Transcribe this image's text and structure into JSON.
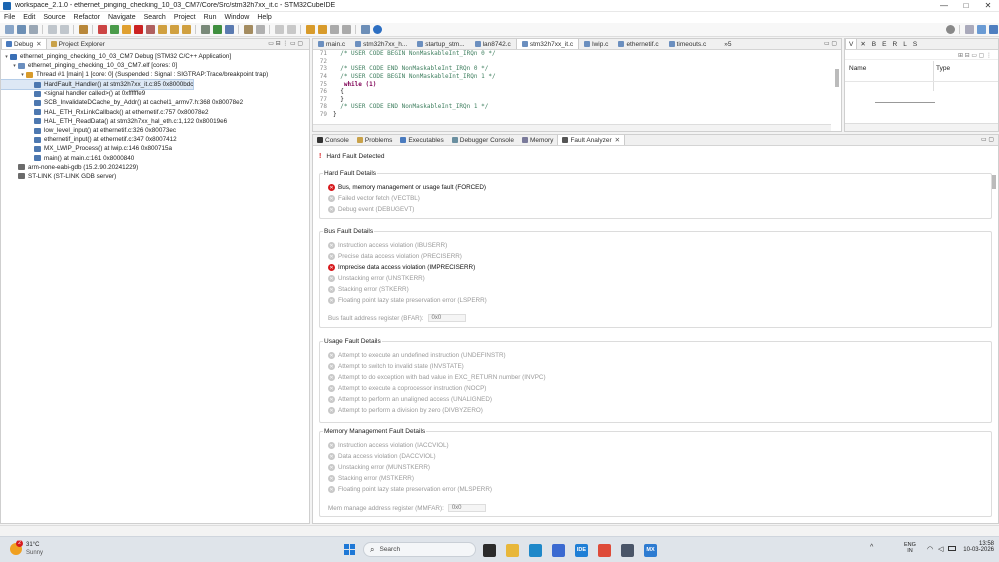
{
  "window": {
    "title": "workspace_2.1.0 - ethernet_pinging_checking_10_03_CM7/Core/Src/stm32h7xx_it.c - STM32CubeIDE",
    "controls": [
      "—",
      "□",
      "✕"
    ]
  },
  "menu": [
    "File",
    "Edit",
    "Source",
    "Refactor",
    "Navigate",
    "Search",
    "Project",
    "Run",
    "Window",
    "Help"
  ],
  "debug_panel": {
    "tabs": [
      {
        "label": "Debug"
      },
      {
        "label": "Project Explorer"
      }
    ],
    "tree": [
      {
        "indent": 0,
        "text": "ethernet_pinging_checking_10_03_CM7 Debug [STM32 C/C++ Application]",
        "twisty": "▾",
        "color": "#3a6fb5"
      },
      {
        "indent": 1,
        "text": "ethernet_pinging_checking_10_03_CM7.elf [cores: 0]",
        "twisty": "▾",
        "color": "#6b8fbf"
      },
      {
        "indent": 2,
        "text": "Thread #1 [main] 1 [core: 0] (Suspended : Signal : SIGTRAP:Trace/breakpoint trap)",
        "twisty": "▾",
        "color": "#d89b2b"
      },
      {
        "indent": 3,
        "text": "HardFault_Handler() at stm32h7xx_it.c:85 0x8000bdc",
        "twisty": "",
        "color": "#4d78b0",
        "selected": true
      },
      {
        "indent": 3,
        "text": "<signal handler called>() at 0xffffffe9",
        "twisty": "",
        "color": "#4d78b0"
      },
      {
        "indent": 3,
        "text": "SCB_InvalidateDCache_by_Addr() at cachel1_armv7.h:368 0x80078e2",
        "twisty": "",
        "color": "#4d78b0"
      },
      {
        "indent": 3,
        "text": "HAL_ETH_RxLinkCallback() at ethernetif.c:757 0x80078e2",
        "twisty": "",
        "color": "#4d78b0"
      },
      {
        "indent": 3,
        "text": "HAL_ETH_ReadData() at stm32h7xx_hal_eth.c:1,122 0x80019e6",
        "twisty": "",
        "color": "#4d78b0"
      },
      {
        "indent": 3,
        "text": "low_level_input() at ethernetif.c:326 0x80073ec",
        "twisty": "",
        "color": "#4d78b0"
      },
      {
        "indent": 3,
        "text": "ethernetif_input() at ethernetif.c:347 0x8007412",
        "twisty": "",
        "color": "#4d78b0"
      },
      {
        "indent": 3,
        "text": "MX_LWIP_Process() at lwip.c:146 0x800715a",
        "twisty": "",
        "color": "#4d78b0"
      },
      {
        "indent": 3,
        "text": "main() at main.c:161 0x8000840",
        "twisty": "",
        "color": "#4d78b0"
      },
      {
        "indent": 1,
        "text": "arm-none-eabi-gdb (15.2.90.20241229)",
        "twisty": "",
        "color": "#6b6b6b"
      },
      {
        "indent": 1,
        "text": "ST-LINK (ST-LINK GDB server)",
        "twisty": "",
        "color": "#6b6b6b"
      }
    ]
  },
  "editor": {
    "tabs": [
      "main.c",
      "stm32h7xx_h...",
      "startup_stm...",
      "lan8742.c",
      "stm32h7xx_it.c",
      "lwip.c",
      "ethernetif.c",
      "timeouts.c",
      "»5"
    ],
    "active_tab": 4,
    "lines": [
      {
        "n": "71",
        "text": "  /* USER CODE BEGIN NonMaskableInt_IRQn 0 */",
        "type": "cm"
      },
      {
        "n": "72",
        "text": "",
        "type": ""
      },
      {
        "n": "73",
        "text": "  /* USER CODE END NonMaskableInt_IRQn 0 */",
        "type": "cm"
      },
      {
        "n": "74",
        "text": "  /* USER CODE BEGIN NonMaskableInt_IRQn 1 */",
        "type": "cm"
      },
      {
        "n": "75",
        "text": "   while (1)",
        "type": "kw"
      },
      {
        "n": "76",
        "text": "  {",
        "type": ""
      },
      {
        "n": "77",
        "text": "  }",
        "type": ""
      },
      {
        "n": "78",
        "text": "  /* USER CODE END NonMaskableInt_IRQn 1 */",
        "type": "cm"
      },
      {
        "n": "79",
        "text": "}",
        "type": ""
      }
    ]
  },
  "vars_panel": {
    "tabs": [
      "V",
      "✕",
      "B",
      "E",
      "R",
      "L",
      "S"
    ],
    "headers": [
      "Name",
      "Type"
    ]
  },
  "bottom_panel": {
    "tabs": [
      "Console",
      "Problems",
      "Executables",
      "Debugger Console",
      "Memory",
      "Fault Analyzer"
    ],
    "active_tab": 5,
    "status": "Hard Fault Detected"
  },
  "fault_analyzer": {
    "hard": {
      "title": "Hard Fault Details",
      "items": [
        {
          "text": "Bus, memory management or usage fault (FORCED)",
          "on": true
        },
        {
          "text": "Failed vector fetch (VECTBL)",
          "on": false
        },
        {
          "text": "Debug event (DEBUGEVT)",
          "on": false
        }
      ]
    },
    "bus": {
      "title": "Bus Fault Details",
      "items": [
        {
          "text": "Instruction access violation (IBUSERR)",
          "on": false
        },
        {
          "text": "Precise data access violation (PRECISERR)",
          "on": false
        },
        {
          "text": "Imprecise data access violation (IMPRECISERR)",
          "on": true
        },
        {
          "text": "Unstacking error (UNSTKERR)",
          "on": false
        },
        {
          "text": "Stacking error (STKERR)",
          "on": false
        },
        {
          "text": "Floating point lazy state preservation error (LSPERR)",
          "on": false
        }
      ],
      "reg_label": "Bus fault address register (BFAR):",
      "reg_value": "0x0"
    },
    "usage": {
      "title": "Usage Fault Details",
      "items": [
        {
          "text": "Attempt to execute an undefined instruction (UNDEFINSTR)",
          "on": false
        },
        {
          "text": "Attempt to switch to invalid state (INVSTATE)",
          "on": false
        },
        {
          "text": "Attempt to do exception with bad value in EXC_RETURN number (INVPC)",
          "on": false
        },
        {
          "text": "Attempt to execute a coprocessor instruction (NOCP)",
          "on": false
        },
        {
          "text": "Attempt to perform an unaligned access (UNALIGNED)",
          "on": false
        },
        {
          "text": "Attempt to perform a division by zero (DIVBYZERO)",
          "on": false
        }
      ]
    },
    "mem": {
      "title": "Memory Management Fault Details",
      "items": [
        {
          "text": "Instruction access violation (IACCVIOL)",
          "on": false
        },
        {
          "text": "Data access violation (DACCVIOL)",
          "on": false
        },
        {
          "text": "Unstacking error (MUNSTKERR)",
          "on": false
        },
        {
          "text": "Stacking error (MSTKERR)",
          "on": false
        },
        {
          "text": "Floating point lazy state preservation error (MLSPERR)",
          "on": false
        }
      ],
      "reg_label": "Mem manage address register (MMFAR):",
      "reg_value": "0x0"
    }
  },
  "taskbar": {
    "weather_temp": "31°C",
    "weather_desc": "Sunny",
    "weather_badge": "2",
    "search_placeholder": "Search",
    "lang_top": "ENG",
    "lang_bottom": "IN",
    "time": "13:58",
    "date": "10-03-2026",
    "pinned": [
      {
        "name": "task-view-icon",
        "color": "#2b2b2b",
        "label": ""
      },
      {
        "name": "file-explorer-icon",
        "color": "#e8b73a",
        "label": ""
      },
      {
        "name": "edge-icon",
        "color": "#1e88c9",
        "label": ""
      },
      {
        "name": "store-icon",
        "color": "#3b6ad1",
        "label": ""
      },
      {
        "name": "stm32cubeide-icon",
        "color": "#1f7fd6",
        "label": "IDE"
      },
      {
        "name": "chrome-icon",
        "color": "#de4b39",
        "label": ""
      },
      {
        "name": "terminal-icon",
        "color": "#4a5568",
        "label": ""
      },
      {
        "name": "stm32cubemx-icon",
        "color": "#2d7bd1",
        "label": "MX"
      }
    ]
  }
}
